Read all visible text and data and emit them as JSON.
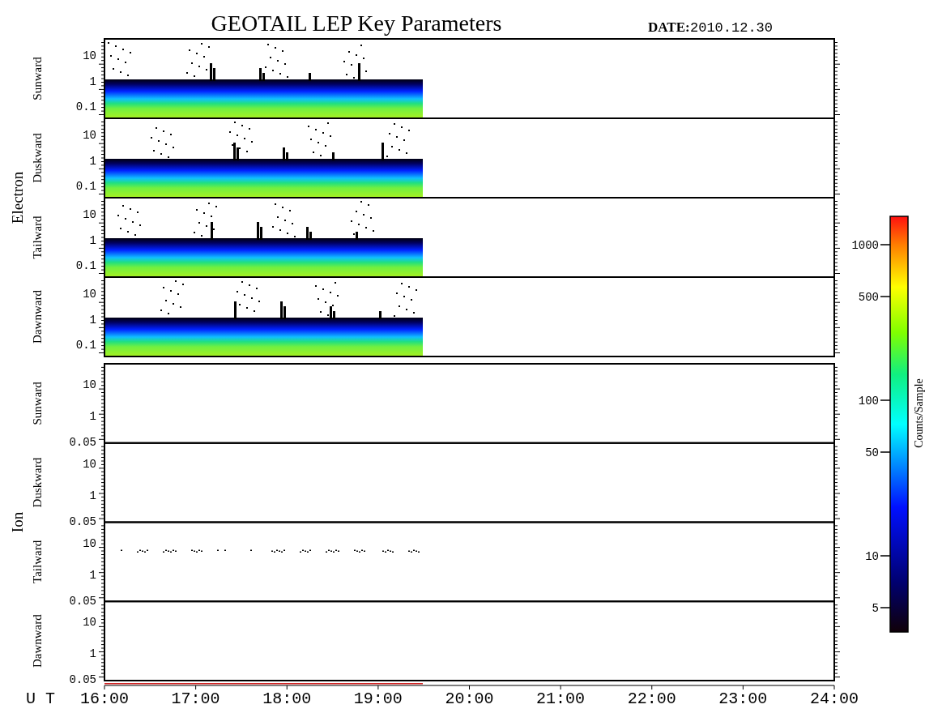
{
  "title": "GEOTAIL LEP Key Parameters",
  "date_label": "DATE:",
  "date": "2010.12.30",
  "groups": [
    {
      "label": "Electron",
      "panels": [
        {
          "label": "Sunward",
          "kind": "spectrogram",
          "yticks": [
            "10",
            "1",
            "0.1"
          ]
        },
        {
          "label": "Duskward",
          "kind": "spectrogram",
          "yticks": [
            "10",
            "1",
            "0.1"
          ]
        },
        {
          "label": "Tailward",
          "kind": "spectrogram",
          "yticks": [
            "10",
            "1",
            "0.1"
          ]
        },
        {
          "label": "Dawnward",
          "kind": "spectrogram",
          "yticks": [
            "10",
            "1",
            "0.1"
          ]
        }
      ]
    },
    {
      "label": "Ion",
      "panels": [
        {
          "label": "Sunward",
          "kind": "empty",
          "yticks": [
            "10",
            "1",
            "0.05"
          ]
        },
        {
          "label": "Duskward",
          "kind": "empty",
          "yticks": [
            "10",
            "1",
            "0.05"
          ]
        },
        {
          "label": "Tailward",
          "kind": "sparse",
          "yticks": [
            "10",
            "1",
            "0.05"
          ]
        },
        {
          "label": "Dawnward",
          "kind": "empty",
          "yticks": [
            "10",
            "1",
            "0.05"
          ]
        }
      ]
    }
  ],
  "colorbar": {
    "label": "Counts/Sample",
    "ticks": [
      "1000",
      "500",
      "100",
      "50",
      "10",
      "5"
    ]
  },
  "x_axis": {
    "label": "U T",
    "ticks": [
      "16:00",
      "17:00",
      "18:00",
      "19:00",
      "20:00",
      "21:00",
      "22:00",
      "23:00",
      "24:00"
    ]
  }
}
